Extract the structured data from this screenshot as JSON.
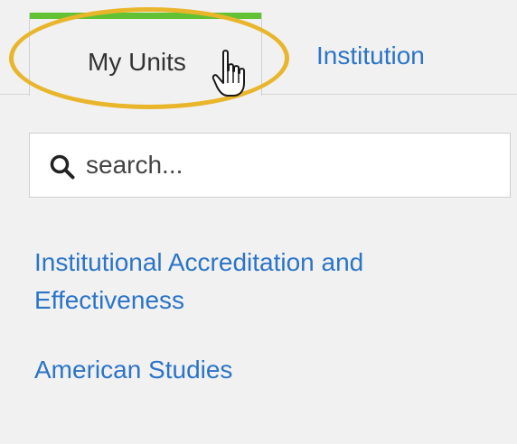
{
  "tabs": {
    "my_units": "My Units",
    "institution": "Institution"
  },
  "search": {
    "placeholder": "search...",
    "value": ""
  },
  "units": [
    {
      "label": "Institutional Accreditation and Effectiveness"
    },
    {
      "label": "American Studies"
    }
  ],
  "colors": {
    "active_tab_bar": "#62c233",
    "link": "#2b74c7",
    "highlight_ring": "#e9b52b",
    "background": "#f1f1f1"
  },
  "icons": {
    "search": "magnifier-icon",
    "cursor": "hand-pointer-icon"
  }
}
